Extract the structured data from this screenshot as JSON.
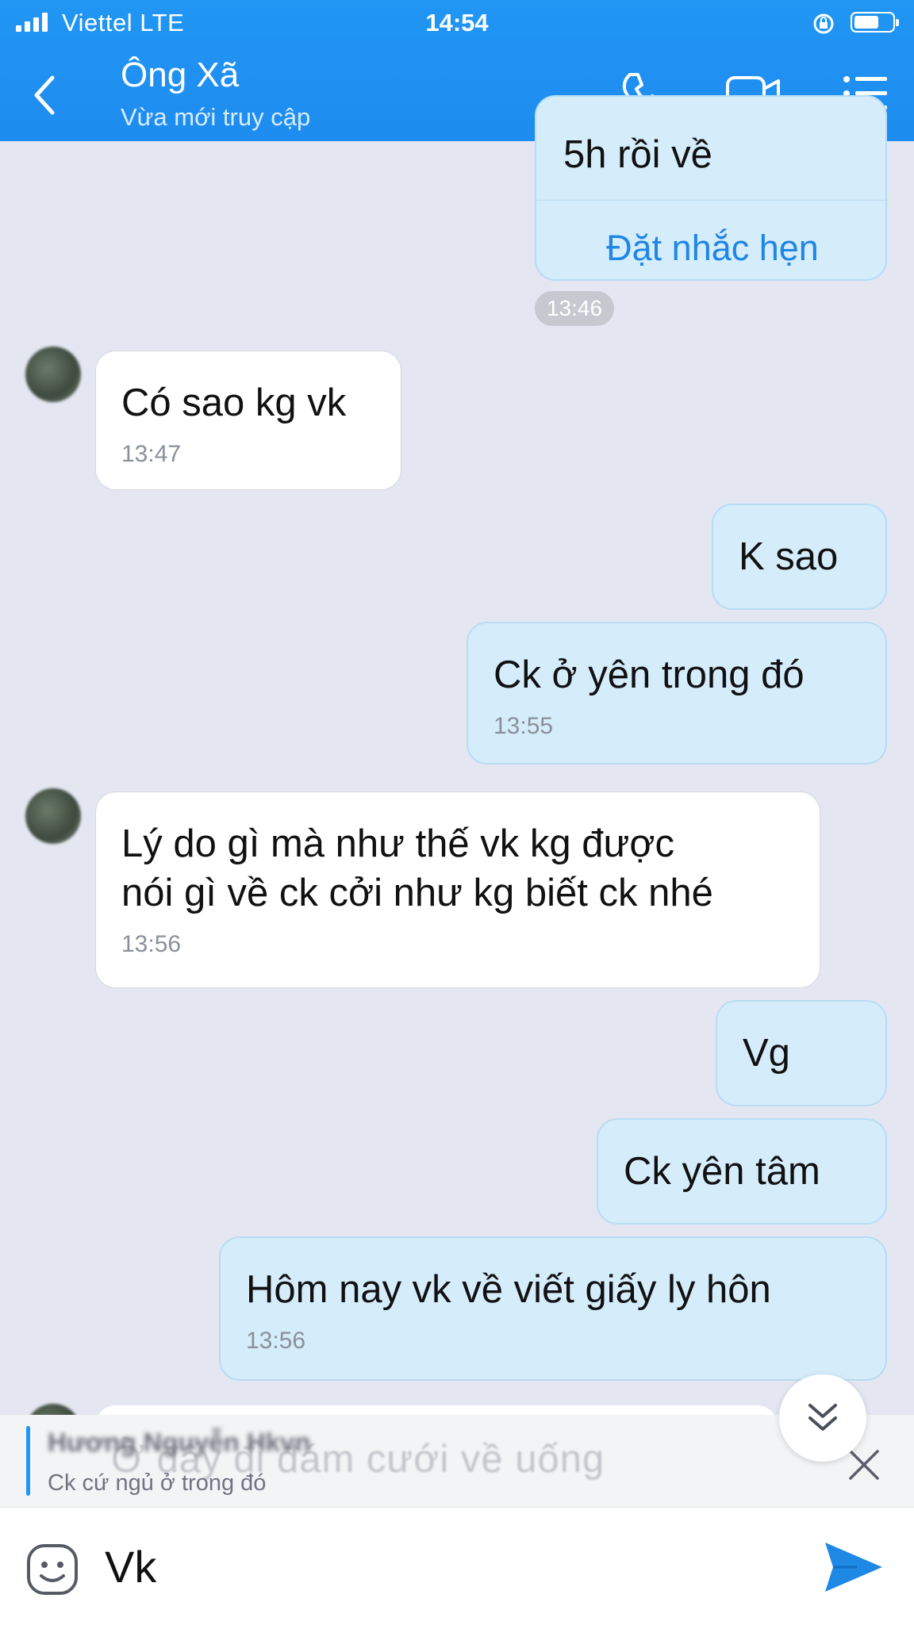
{
  "status_bar": {
    "carrier": "Viettel  LTE",
    "time": "14:54"
  },
  "header": {
    "title": "Ông Xã",
    "subtitle": "Vừa mới truy cập"
  },
  "messages": {
    "top_fragment": "5h rồi về",
    "reminder_label": "Đặt nhắc hẹn",
    "separator_time": "13:46",
    "m1": {
      "text": "Có sao kg vk",
      "time": "13:47"
    },
    "m2": {
      "text": "K sao"
    },
    "m3": {
      "text": "Ck ở yên trong đó",
      "time": "13:55"
    },
    "m4": {
      "line1": "Lý do gì mà như thế vk kg được",
      "line2": "nói gì về ck cởi như kg biết ck nhé",
      "time": "13:56"
    },
    "m5": {
      "text": "Vg"
    },
    "m6": {
      "text": "Ck yên tâm"
    },
    "m7": {
      "text": "Hôm nay vk về viết giấy ly hôn",
      "time": "13:56"
    }
  },
  "reply_preview": {
    "author": "Hương Nguyễn Hkvn",
    "text": "Ck cứ ngủ ở trong đó",
    "ghost_text": "Ở đấy đi đám cưới về uống"
  },
  "composer": {
    "value": "Vk"
  },
  "colors": {
    "header": "#2196f3",
    "outgoing": "#d5ecfb",
    "incoming": "#ffffff",
    "background": "#e4e7f2"
  }
}
